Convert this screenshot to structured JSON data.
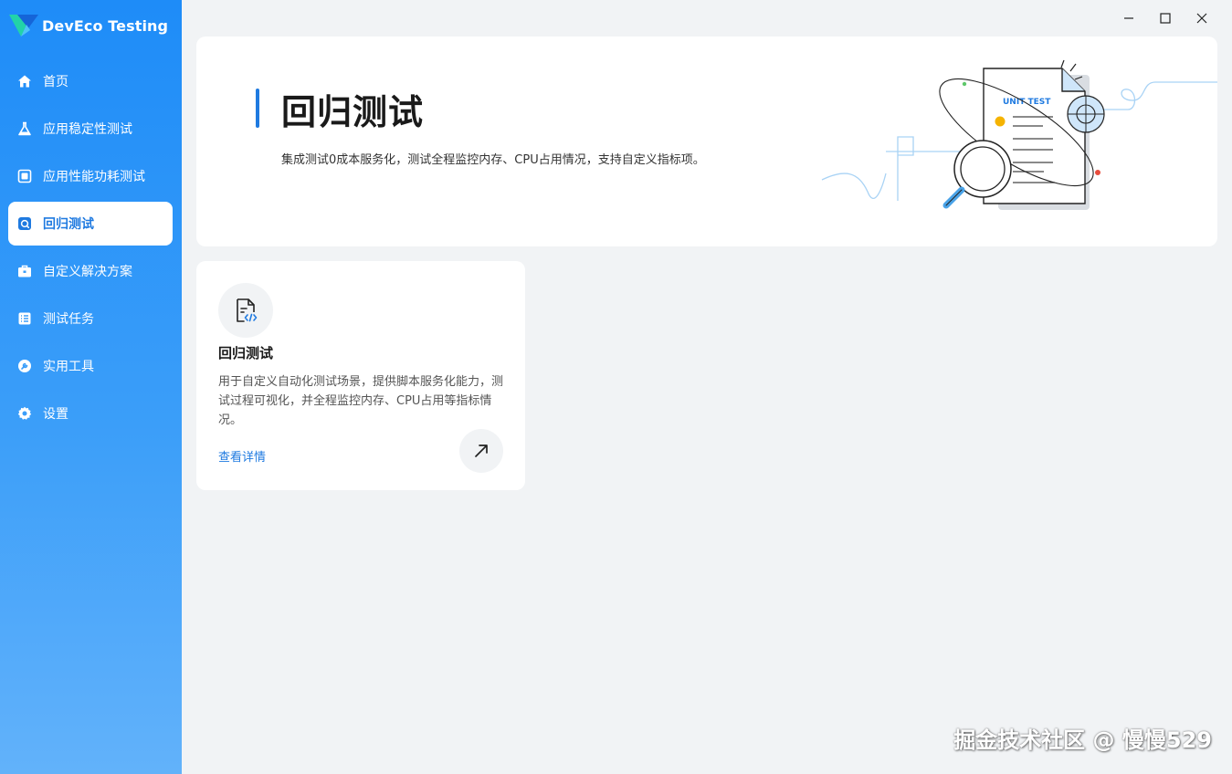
{
  "app": {
    "brand": "DevEco Testing"
  },
  "sidebar": {
    "items": [
      {
        "label": "首页",
        "icon": "home-icon"
      },
      {
        "label": "应用稳定性测试",
        "icon": "flask-icon"
      },
      {
        "label": "应用性能功耗测试",
        "icon": "chip-icon"
      },
      {
        "label": "回归测试",
        "icon": "regression-icon",
        "active": true
      },
      {
        "label": "自定义解决方案",
        "icon": "toolbox-icon"
      },
      {
        "label": "测试任务",
        "icon": "list-icon"
      },
      {
        "label": "实用工具",
        "icon": "wrench-icon"
      },
      {
        "label": "设置",
        "icon": "gear-icon"
      }
    ]
  },
  "window": {
    "controls": [
      "minimize-icon",
      "maximize-icon",
      "close-icon"
    ]
  },
  "hero": {
    "title": "回归测试",
    "description": "集成测试0成本服务化，测试全程监控内存、CPU占用情况，支持自定义指标项。",
    "illustration_label": "UNIT TEST"
  },
  "card": {
    "title": "回归测试",
    "description": "用于自定义自动化测试场景，提供脚本服务化能力，测试过程可视化，并全程监控内存、CPU占用等指标情况。",
    "link": "查看详情"
  },
  "watermark": "掘金技术社区 @ 慢慢529",
  "colors": {
    "accent": "#1f7ae0",
    "sidebar_top": "#1e8cf8",
    "sidebar_bottom": "#62b2fa",
    "background": "#f1f3f5"
  }
}
